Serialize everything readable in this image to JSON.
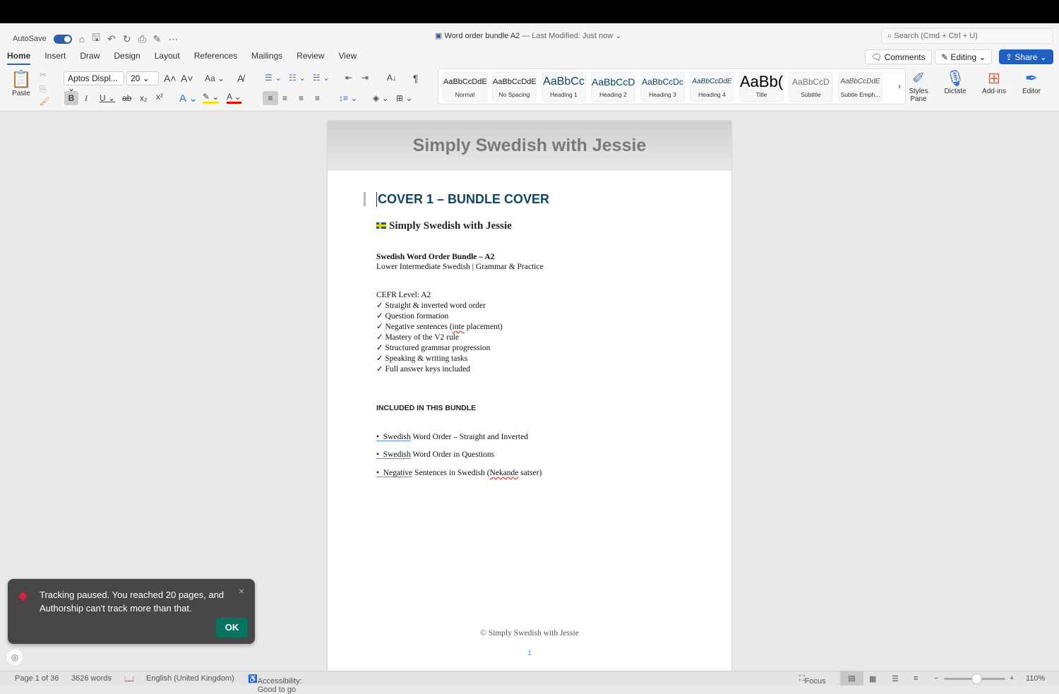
{
  "app": {
    "autosave_label": "AutoSave",
    "doc_title": "Word order bundle A2",
    "last_modified": "— Last Modified: Just now",
    "search_placeholder": "Search (Cmd + Ctrl + U)"
  },
  "tabs": [
    "Home",
    "Insert",
    "Draw",
    "Design",
    "Layout",
    "References",
    "Mailings",
    "Review",
    "View"
  ],
  "actions": {
    "comments": "Comments",
    "editing": "Editing",
    "share": "Share"
  },
  "ribbon": {
    "paste": "Paste",
    "font": "Aptos Displ...",
    "size": "20",
    "change_case": "Aa",
    "styles_pane": "Styles Pane",
    "dictate": "Dictate",
    "addins": "Add-ins",
    "editor": "Editor"
  },
  "styles": [
    {
      "preview": "AaBbCcDdE",
      "label": "Normal"
    },
    {
      "preview": "AaBbCcDdE",
      "label": "No Spacing"
    },
    {
      "preview": "AaBbCc",
      "label": "Heading 1"
    },
    {
      "preview": "AaBbCcD",
      "label": "Heading 2"
    },
    {
      "preview": "AaBbCcDc",
      "label": "Heading 3"
    },
    {
      "preview": "AaBbCcDdE",
      "label": "Heading 4"
    },
    {
      "preview": "AaBb(",
      "label": "Title"
    },
    {
      "preview": "AaBbCcD",
      "label": "Subtitle"
    },
    {
      "preview": "AaBbCcDdE",
      "label": "Subtle Emph..."
    }
  ],
  "doc": {
    "header": "Simply Swedish with Jessie",
    "heading": "COVER 1 – BUNDLE COVER",
    "brand": "Simply Swedish with Jessie",
    "bundle_title": "Swedish Word Order Bundle – A2",
    "subtitle": "Lower Intermediate Swedish | Grammar & Practice",
    "cefr": "CEFR Level: A2",
    "checks": [
      "Straight & inverted word order",
      "Question formation",
      "Negative sentences (inte placement)",
      "Mastery of the V2 rule",
      "Structured grammar progression",
      "Speaking & writing tasks",
      "Full answer keys included"
    ],
    "included_heading": "INCLUDED IN THIS BUNDLE",
    "included": [
      {
        "first": "Swedish",
        "rest": " Word Order – Straight and Inverted"
      },
      {
        "first": "Swedish",
        "rest": " Word Order in Questions"
      },
      {
        "first": "Negative",
        "rest": " Sentences in Swedish (Nekande satser)"
      }
    ],
    "footer": "© Simply Swedish with Jessie",
    "page_number": "1"
  },
  "toast": {
    "message": "Tracking paused. You reached 20 pages, and Authorship can't track more than that.",
    "ok": "OK"
  },
  "status": {
    "page": "Page 1 of 36",
    "words": "3626 words",
    "language": "English (United Kingdom)",
    "accessibility": "Accessibility: Good to go",
    "focus": "Focus",
    "zoom": "110%",
    "zoom_percent": 110
  }
}
